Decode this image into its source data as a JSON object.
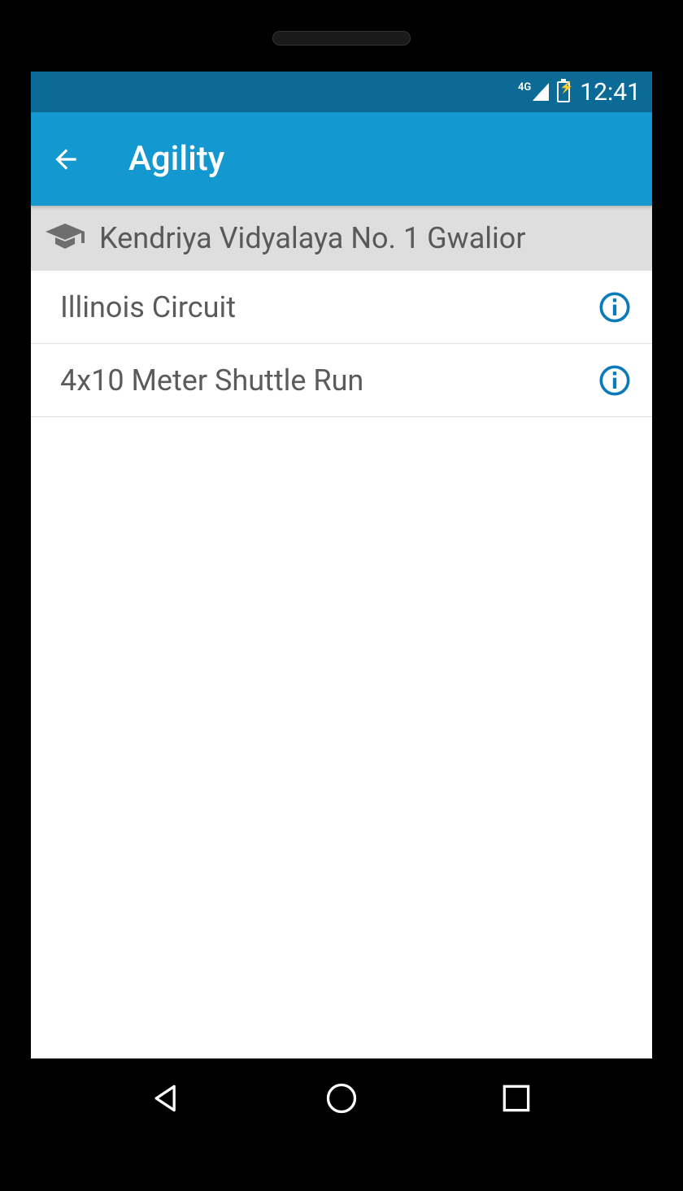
{
  "status_bar": {
    "network_label": "4G",
    "time": "12:41"
  },
  "app_bar": {
    "title": "Agility"
  },
  "school": {
    "name": "Kendriya Vidyalaya No. 1 Gwalior"
  },
  "items": [
    {
      "label": "Illinois Circuit"
    },
    {
      "label": "4x10 Meter Shuttle Run"
    }
  ]
}
